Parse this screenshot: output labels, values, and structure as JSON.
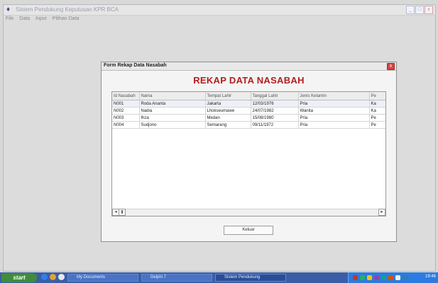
{
  "window": {
    "title": "Sistem Pendukung Keputusan KPR BCA",
    "buttons": [
      "_",
      "□",
      "x"
    ]
  },
  "menubar": [
    "File",
    "Data",
    "Input",
    "Pilihan Data"
  ],
  "dialog": {
    "title": "Form Rekap Data Nasabah",
    "close_label": "x",
    "heading": "REKAP DATA NASABAH",
    "columns": [
      "Id Nasabah",
      "Nama",
      "Tempat Lahir",
      "Tanggal Lahir",
      "Jenis Kelamin",
      "Pe"
    ],
    "rows": [
      [
        "N001",
        "Roda Ananta",
        "Jakarta",
        "12/03/1976",
        "Pria",
        "Ka"
      ],
      [
        "N002",
        "Nadia",
        "Lhokseumawe",
        "24/07/1982",
        "Wanita",
        "Ka"
      ],
      [
        "N003",
        "Ihza",
        "Medan",
        "15/08/1980",
        "Pria",
        "Pe"
      ],
      [
        "N004",
        "Sudjono",
        "Semarang",
        "09/11/1972",
        "Pria",
        "Pe"
      ]
    ],
    "close_button": "Keluar"
  },
  "taskbar": {
    "start_label": "start",
    "tasks": [
      "My Documents",
      "Delphi 7",
      "Sistem Pendukung"
    ],
    "clock": "19:48"
  },
  "colors": {
    "accent_red": "#b31d1d",
    "taskbar_blue": "#3a5ea5",
    "start_green": "#3f8d3a"
  }
}
